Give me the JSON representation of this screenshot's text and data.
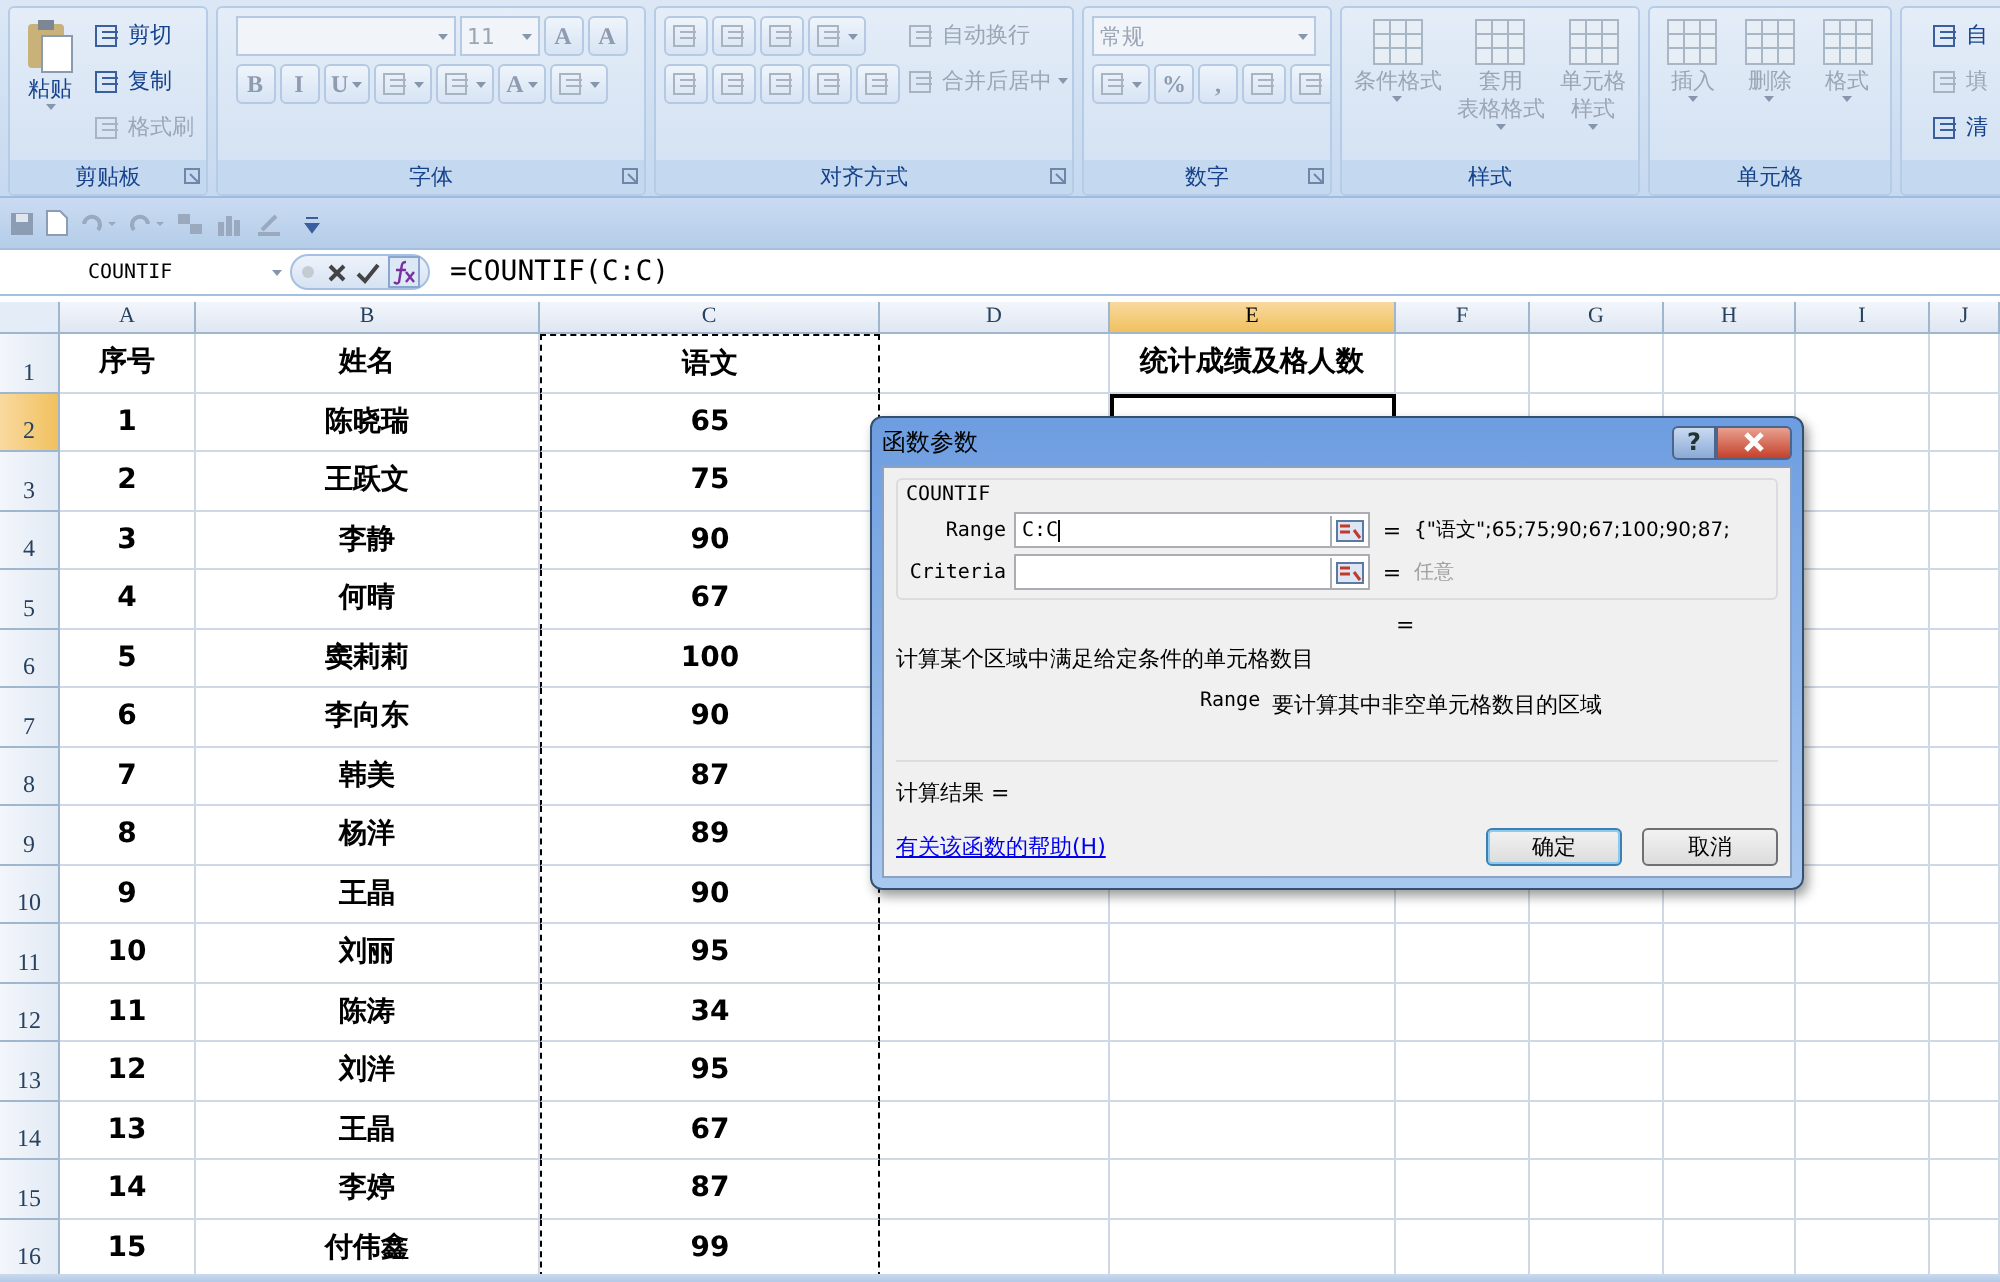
{
  "ribbon": {
    "groups": [
      {
        "label": "剪贴板",
        "launcher": true,
        "columns": [
          [
            {
              "kind": "big",
              "text": "粘贴",
              "drop": true,
              "disabled": false
            }
          ],
          [
            {
              "kind": "small",
              "text": "剪切",
              "disabled": false
            },
            {
              "kind": "small",
              "text": "复制",
              "disabled": false
            },
            {
              "kind": "small",
              "text": "格式刷",
              "disabled": true
            }
          ]
        ]
      },
      {
        "label": "字体",
        "launcher": true,
        "columns": [
          [
            {
              "kind": "row",
              "items": [
                {
                  "kind": "font-combo",
                  "disabled": true
                },
                {
                  "kind": "size-combo",
                  "value": "11",
                  "disabled": true
                },
                {
                  "kind": "tool",
                  "text": "A",
                  "disabled": true
                },
                {
                  "kind": "tool",
                  "text": "A",
                  "disabled": true
                }
              ]
            },
            {
              "kind": "row",
              "items": [
                {
                  "kind": "tool",
                  "text": "B",
                  "disabled": true
                },
                {
                  "kind": "tool",
                  "text": "I",
                  "disabled": true
                },
                {
                  "kind": "tool",
                  "text": "U",
                  "drop": true,
                  "disabled": true
                },
                {
                  "kind": "tool",
                  "drop": true,
                  "disabled": true
                },
                {
                  "kind": "tool",
                  "drop": true,
                  "disabled": true
                },
                {
                  "kind": "tool",
                  "text": "A",
                  "drop": true,
                  "disabled": true
                },
                {
                  "kind": "tool",
                  "drop": true,
                  "disabled": true
                }
              ]
            }
          ]
        ]
      },
      {
        "label": "对齐方式",
        "launcher": true,
        "columns": [
          [
            {
              "kind": "row",
              "items": [
                {
                  "kind": "tool",
                  "disabled": true
                },
                {
                  "kind": "tool",
                  "disabled": true
                },
                {
                  "kind": "tool",
                  "disabled": true
                },
                {
                  "kind": "tool",
                  "drop": true,
                  "disabled": true
                }
              ]
            },
            {
              "kind": "row",
              "items": [
                {
                  "kind": "tool",
                  "disabled": true
                },
                {
                  "kind": "tool",
                  "disabled": true
                },
                {
                  "kind": "tool",
                  "disabled": true
                },
                {
                  "kind": "tool",
                  "disabled": true
                },
                {
                  "kind": "tool",
                  "disabled": true
                }
              ]
            }
          ],
          [
            {
              "kind": "small",
              "text": "自动换行",
              "disabled": true
            },
            {
              "kind": "small",
              "text": "合并后居中",
              "drop": true,
              "disabled": true
            }
          ]
        ]
      },
      {
        "label": "数字",
        "launcher": true,
        "columns": [
          [
            {
              "kind": "format-combo",
              "value": "常规",
              "disabled": true
            },
            {
              "kind": "row",
              "items": [
                {
                  "kind": "tool",
                  "drop": true,
                  "disabled": true
                },
                {
                  "kind": "tool",
                  "text": "%",
                  "disabled": true
                },
                {
                  "kind": "tool",
                  "text": ",",
                  "disabled": true
                },
                {
                  "kind": "tool",
                  "disabled": true
                },
                {
                  "kind": "tool",
                  "disabled": true
                }
              ]
            }
          ]
        ]
      },
      {
        "label": "样式",
        "columns": [
          [
            {
              "kind": "big",
              "text": "条件格式",
              "drop": true,
              "disabled": true
            }
          ],
          [
            {
              "kind": "big",
              "lines": [
                "套用",
                "表格格式"
              ],
              "drop": true,
              "disabled": true
            }
          ],
          [
            {
              "kind": "big",
              "lines": [
                "单元格",
                "样式"
              ],
              "drop": true,
              "disabled": true
            }
          ]
        ]
      },
      {
        "label": "单元格",
        "columns": [
          [
            {
              "kind": "big",
              "text": "插入",
              "drop": true,
              "disabled": true
            }
          ],
          [
            {
              "kind": "big",
              "text": "删除",
              "drop": true,
              "disabled": true
            }
          ],
          [
            {
              "kind": "big",
              "text": "格式",
              "drop": true,
              "disabled": true
            }
          ]
        ]
      },
      {
        "columns": [
          [
            {
              "kind": "small",
              "text": "自",
              "disabled": false
            },
            {
              "kind": "small",
              "text": "填",
              "disabled": true
            },
            {
              "kind": "small",
              "text": "清",
              "disabled": false
            }
          ]
        ]
      }
    ]
  },
  "formula_bar": {
    "name_box": "COUNTIF",
    "formula": "=COUNTIF(C:C)"
  },
  "sheet": {
    "columns": [
      {
        "label": "A",
        "selected": false,
        "marquee": false
      },
      {
        "label": "B",
        "selected": false,
        "marquee": false
      },
      {
        "label": "C",
        "selected": false,
        "marquee": true
      },
      {
        "label": "D",
        "selected": false,
        "marquee": false
      },
      {
        "label": "E",
        "selected": true,
        "marquee": false
      },
      {
        "label": "F",
        "selected": false,
        "marquee": false
      },
      {
        "label": "G",
        "selected": false,
        "marquee": false
      },
      {
        "label": "H",
        "selected": false,
        "marquee": false
      },
      {
        "label": "I",
        "selected": false,
        "marquee": false
      },
      {
        "label": "J",
        "selected": false,
        "marquee": false
      }
    ],
    "rows": [
      {
        "number": "1",
        "selected": false,
        "cells": {
          "A": "序号",
          "B": "姓名",
          "C": "语文",
          "E": "统计成绩及格人数"
        }
      },
      {
        "number": "2",
        "selected": true,
        "cells": {
          "A": "1",
          "B": "陈晓瑞",
          "C": "65"
        }
      },
      {
        "number": "3",
        "selected": false,
        "cells": {
          "A": "2",
          "B": "王跃文",
          "C": "75"
        }
      },
      {
        "number": "4",
        "selected": false,
        "cells": {
          "A": "3",
          "B": "李静",
          "C": "90"
        }
      },
      {
        "number": "5",
        "selected": false,
        "cells": {
          "A": "4",
          "B": "何晴",
          "C": "67"
        }
      },
      {
        "number": "6",
        "selected": false,
        "cells": {
          "A": "5",
          "B": "窦莉莉",
          "C": "100"
        }
      },
      {
        "number": "7",
        "selected": false,
        "cells": {
          "A": "6",
          "B": "李向东",
          "C": "90"
        }
      },
      {
        "number": "8",
        "selected": false,
        "cells": {
          "A": "7",
          "B": "韩美",
          "C": "87"
        }
      },
      {
        "number": "9",
        "selected": false,
        "cells": {
          "A": "8",
          "B": "杨洋",
          "C": "89"
        }
      },
      {
        "number": "10",
        "selected": false,
        "cells": {
          "A": "9",
          "B": "王晶",
          "C": "90"
        }
      },
      {
        "number": "11",
        "selected": false,
        "cells": {
          "A": "10",
          "B": "刘丽",
          "C": "95"
        }
      },
      {
        "number": "12",
        "selected": false,
        "cells": {
          "A": "11",
          "B": "陈涛",
          "C": "34"
        }
      },
      {
        "number": "13",
        "selected": false,
        "cells": {
          "A": "12",
          "B": "刘洋",
          "C": "95"
        }
      },
      {
        "number": "14",
        "selected": false,
        "cells": {
          "A": "13",
          "B": "王晶",
          "C": "67"
        }
      },
      {
        "number": "15",
        "selected": false,
        "cells": {
          "A": "14",
          "B": "李婷",
          "C": "87"
        }
      },
      {
        "number": "16",
        "selected": false,
        "cells": {
          "A": "15",
          "B": "付伟鑫",
          "C": "99"
        }
      }
    ]
  },
  "dialog": {
    "title": "函数参数",
    "help_button": "?",
    "function_name": "COUNTIF",
    "arguments": [
      {
        "label": "Range",
        "value": "C:C",
        "result": "{\"语文\";65;75;90;67;100;90;87;",
        "muted": false
      },
      {
        "label": "Criteria",
        "result": "任意",
        "muted": true
      }
    ],
    "equals": "=",
    "total_equals": "=",
    "description": "计算某个区域中满足给定条件的单元格数目",
    "argument_help_label": "Range",
    "argument_help": "要计算其中非空单元格数目的区域",
    "result_label": "计算结果 =",
    "help_link": "有关该函数的帮助(H)",
    "buttons": [
      {
        "label": "确定",
        "default": true
      },
      {
        "label": "取消",
        "default": false
      }
    ]
  }
}
